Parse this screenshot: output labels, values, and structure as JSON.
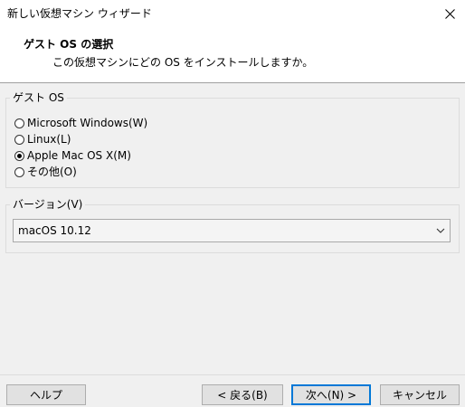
{
  "window": {
    "title": "新しい仮想マシン ウィザード"
  },
  "header": {
    "heading": "ゲスト OS の選択",
    "subheading": "この仮想マシンにどの OS をインストールしますか。"
  },
  "guest_os": {
    "label": "ゲスト OS",
    "options": [
      {
        "label": "Microsoft Windows(W)",
        "selected": false
      },
      {
        "label": "Linux(L)",
        "selected": false
      },
      {
        "label": "Apple Mac OS X(M)",
        "selected": true
      },
      {
        "label": "その他(O)",
        "selected": false
      }
    ]
  },
  "version": {
    "label": "バージョン(V)",
    "selected": "macOS 10.12"
  },
  "buttons": {
    "help": "ヘルプ",
    "back": "< 戻る(B)",
    "next": "次へ(N) >",
    "cancel": "キャンセル"
  },
  "colors": {
    "accent": "#0078d7"
  }
}
